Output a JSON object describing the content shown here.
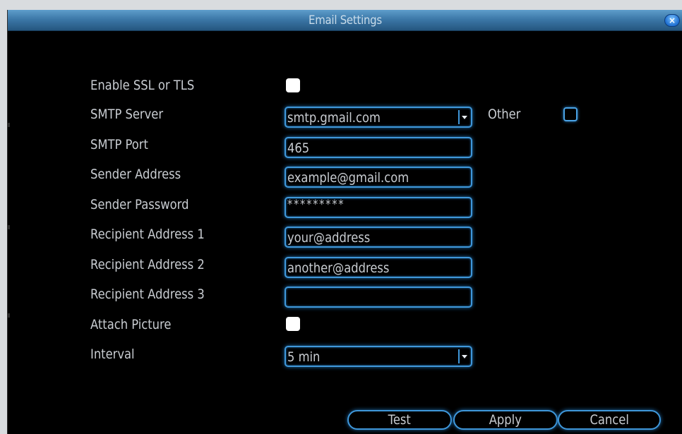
{
  "window": {
    "title": "Email Settings",
    "close_glyph": "×"
  },
  "form": {
    "enable_ssl_label": "Enable SSL or TLS",
    "enable_ssl_checked": false,
    "smtp_server_label": "SMTP Server",
    "smtp_server_value": "smtp.gmail.com",
    "other_label": "Other",
    "other_checked": false,
    "smtp_port_label": "SMTP Port",
    "smtp_port_value": "465",
    "sender_address_label": "Sender Address",
    "sender_address_value": "example@gmail.com",
    "sender_password_label": "Sender Password",
    "sender_password_value": "*********",
    "recipient1_label": "Recipient Address 1",
    "recipient1_value": "your@address",
    "recipient2_label": "Recipient Address 2",
    "recipient2_value": "another@address",
    "recipient3_label": "Recipient Address 3",
    "recipient3_value": "",
    "attach_picture_label": "Attach Picture",
    "attach_picture_checked": false,
    "interval_label": "Interval",
    "interval_value": "5 min"
  },
  "buttons": {
    "test": "Test",
    "apply": "Apply",
    "cancel": "Cancel"
  },
  "colors": {
    "accent": "#3f97da",
    "title_bar": "#3c78a8",
    "background": "#000000",
    "text": "#c9cdd2"
  }
}
